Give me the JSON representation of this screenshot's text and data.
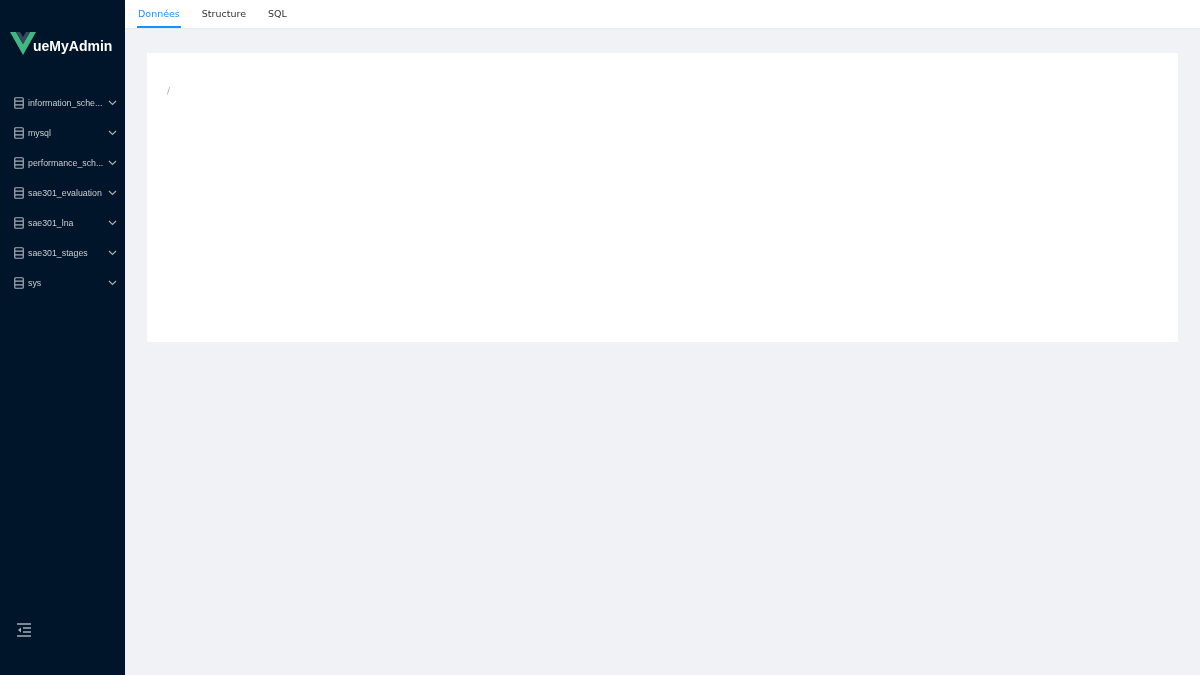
{
  "logo": {
    "text": "ueMyAdmin"
  },
  "databases": [
    {
      "name": "information_sche...",
      "expanded": false
    },
    {
      "name": "mysql",
      "expanded": false
    },
    {
      "name": "performance_sch...",
      "expanded": false
    },
    {
      "name": "sae301_evaluation",
      "expanded": false
    },
    {
      "name": "sae301_lna",
      "expanded": false
    },
    {
      "name": "sae301_stages",
      "expanded": false
    },
    {
      "name": "sys",
      "expanded": false
    }
  ],
  "tabs": [
    {
      "label": "Données",
      "selected": true
    },
    {
      "label": "Structure",
      "selected": false
    },
    {
      "label": "SQL",
      "selected": false
    }
  ],
  "breadcrumb": "/"
}
